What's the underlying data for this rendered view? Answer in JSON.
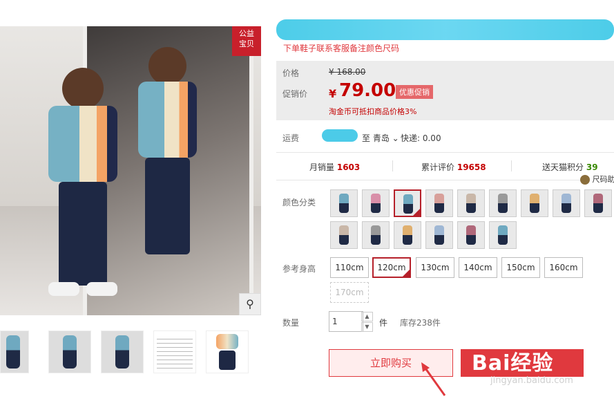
{
  "image": {
    "badge": "公益\n宝贝"
  },
  "subtitle": "下单鞋子联系客服备注颜色尺码",
  "price": {
    "label_price": "价格",
    "original": "¥ 168.00",
    "label_promo": "促销价",
    "currency": "¥",
    "promo": "79.00",
    "tag": "优惠促销",
    "coin_note": "淘金币可抵扣商品价格3%"
  },
  "shipping": {
    "label": "运费",
    "to": "至 青岛",
    "express": "快递: 0.00"
  },
  "stats": {
    "monthly_label": "月销量",
    "monthly": "1603",
    "reviews_label": "累计评价",
    "reviews": "19658",
    "points_label": "送天猫积分",
    "points": "39",
    "size_chart": "尺码助手"
  },
  "color": {
    "label": "颜色分类"
  },
  "height": {
    "label": "参考身高",
    "options": [
      "110cm",
      "120cm",
      "130cm",
      "140cm",
      "150cm",
      "160cm",
      "170cm"
    ]
  },
  "quantity": {
    "label": "数量",
    "value": "1",
    "unit": "件",
    "stock": "库存238件"
  },
  "buy": {
    "label": "立即购买"
  },
  "watermark": {
    "brand": "Bai经验",
    "url": "jingyan.baidu.com"
  },
  "colors": {
    "accent": "#c40000",
    "tmall_red": "#e0393e",
    "blur_blue": "#4ccbe8"
  }
}
